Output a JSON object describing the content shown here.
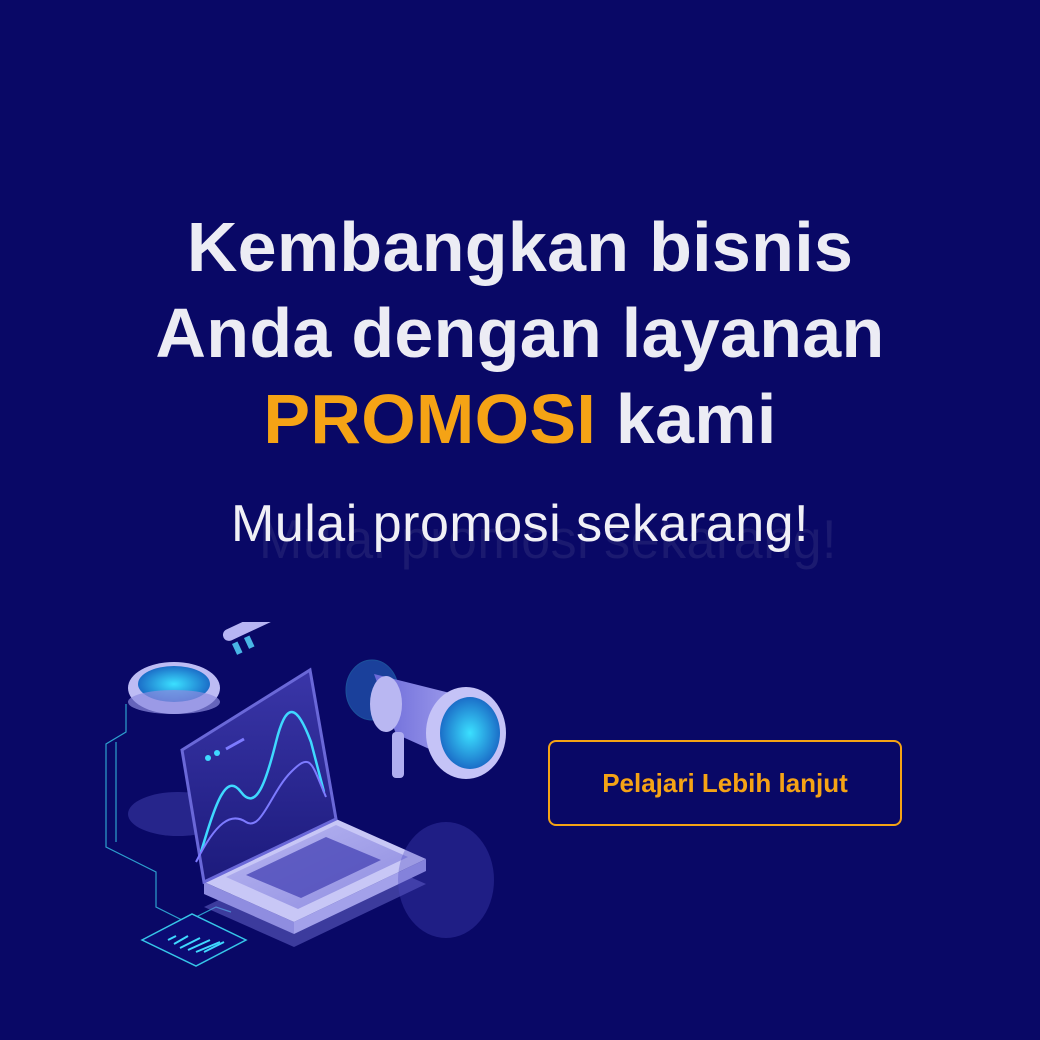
{
  "banner": {
    "headline_line1": "Kembangkan bisnis",
    "headline_line2": "Anda dengan layanan",
    "headline_accent": "PROMOSI",
    "headline_tail": " kami",
    "subheadline": "Mulai promosi sekarang!",
    "cta_label": "Pelajari Lebih lanjut"
  },
  "colors": {
    "background": "#090866",
    "text": "#ececf4",
    "accent": "#f5a315",
    "illustration_primary": "#8f8de8",
    "illustration_glow": "#4fd1ff"
  },
  "illustration": {
    "icons": [
      "magnifier-icon",
      "laptop-icon",
      "megaphone-icon",
      "circuit-chip-icon"
    ]
  }
}
